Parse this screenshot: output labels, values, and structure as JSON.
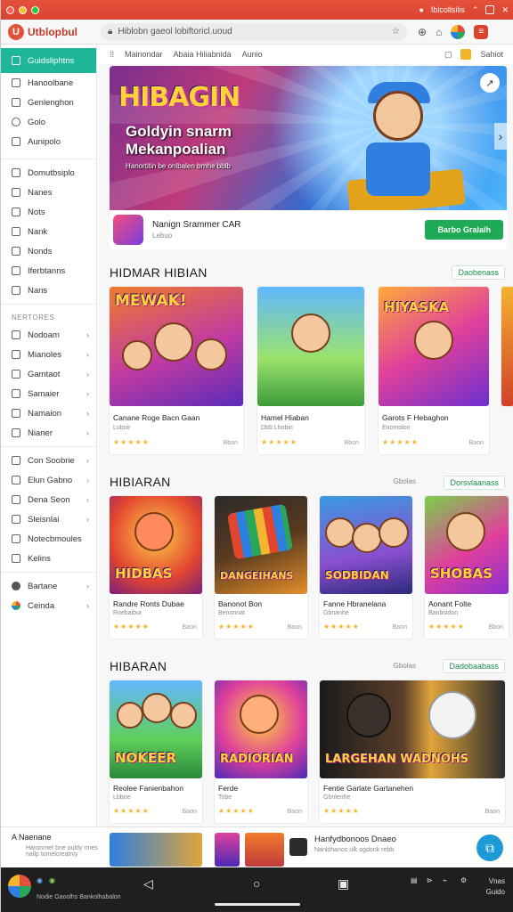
{
  "colors": {
    "accent": "#1fb79a",
    "brand": "#e4513a",
    "cta": "#1faa55",
    "star": "#f3b52d"
  },
  "titlebar": {
    "right_text": "Iblcollsilis"
  },
  "app": {
    "logo_letter": "U",
    "name": "Utblopbul"
  },
  "address": {
    "url": "Hiblobn gaeol lobiftoricl.uoud",
    "profile_label": "Sahiot"
  },
  "sidebar": {
    "active": {
      "label": "Guidsliphtns",
      "icon": "store-icon"
    },
    "top_items": [
      "Hanoolbane",
      "Genlenghon",
      "Golo",
      "Aunipolo"
    ],
    "group1": [
      "Domutbsiplo",
      "Nanes",
      "Nots",
      "Nank",
      "Nonds",
      "Iferbtanns",
      "Nans"
    ],
    "group_heading": "NERTORES",
    "group2": [
      "Nodoam",
      "Mianoles",
      "Gamtaot",
      "Samaier",
      "Namaion",
      "Nianer"
    ],
    "group3": [
      "Con Soobrie",
      "Elun Gabno",
      "Dena Seon",
      "Sleisnlai",
      "Notecbmoules",
      "Kelins"
    ],
    "group4": [
      "Bartane",
      "Ceinda"
    ]
  },
  "subnav": {
    "items": [
      "Mainondar",
      "Abaia Hiliabnida",
      "Aunio"
    ]
  },
  "hero": {
    "word": "HIBAGIN",
    "title": "Goldyin snarm Mekanpoalian",
    "subtitle": "Hanortitin be onlbalen brnhe bblb",
    "app_name": "Nanign Srammer CAR",
    "app_dev": "Lebuo",
    "cta": "Barbo Gralaih"
  },
  "sections": [
    {
      "title": "HIDMAR HIBIAN",
      "see_all": "Daobenass",
      "see_sub": "",
      "cards": [
        {
          "word": "MEWAK!",
          "title": "Canane Roge Bacn Gaan",
          "dev": "Loboir",
          "price": "Bban"
        },
        {
          "word": "",
          "title": "Hamel Hiaban",
          "dev": "Dbb Lhobin",
          "price": "Bbon"
        },
        {
          "word": "HIYASKA",
          "title": "Garots F Hebaghon",
          "dev": "Enomolon",
          "price": "Baon"
        }
      ]
    },
    {
      "title": "HIBIARAN",
      "see_all": "Dorsvlaanass",
      "see_sub": "Gbolas",
      "cards": [
        {
          "word": "HIDBAS",
          "title": "Randre Ronts Dubae",
          "dev": "Roebaibur",
          "price": "Baon"
        },
        {
          "word": "DANGEIHANS",
          "title": "Banonot Bon",
          "dev": "Benonnat",
          "price": "Baon"
        },
        {
          "word": "SODBIDAN",
          "title": "Fanne Hbranelana",
          "dev": "Gbnanhe",
          "price": "Baon"
        },
        {
          "word": "SHOBAS",
          "title": "Aonant Folte",
          "dev": "Banbsidon",
          "price": "Bbon"
        }
      ]
    },
    {
      "title": "HIBARAN",
      "see_all": "Dadobaabass",
      "see_sub": "Gbolas",
      "cards": [
        {
          "word": "NOKEER",
          "title": "Reolee Fanienbahon",
          "dev": "Lbboe",
          "price": "Baon"
        },
        {
          "word": "RADIORIAN",
          "title": "Ferde",
          "dev": "Tobe",
          "price": "Baon"
        },
        {
          "word": "LARGEHAN  WADNOHS",
          "title": "Fentie Garlate Gartanehen",
          "dev": "Gbnlenhe",
          "price": "Baon"
        }
      ]
    }
  ],
  "stars": "★★★★★",
  "bottom": {
    "label": "Naenane",
    "sub": "Haronrnet bne ouldy rmes nallp tumelcreatnly",
    "title": "Hanfydbonoos Dnaeo",
    "sub2": "Nanlohanos ulk ogdonk rebb"
  },
  "system": {
    "label": "Nodie Gaoolhs Bankolhabalon",
    "status_top": "Vnas",
    "status_bottom": "Guido"
  }
}
